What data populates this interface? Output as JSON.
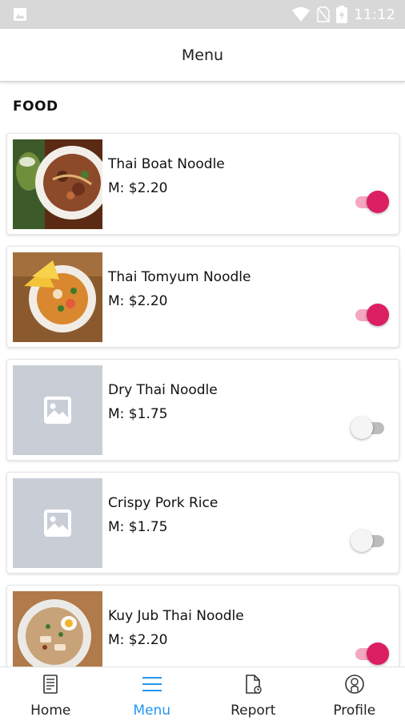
{
  "status_bar": {
    "time": "11:12"
  },
  "app_bar": {
    "title": "Menu"
  },
  "section": {
    "title": "FOOD"
  },
  "items": [
    {
      "name": "Thai Boat Noodle",
      "price": "M: $2.20",
      "enabled": true,
      "image": "boat-noodle-photo"
    },
    {
      "name": "Thai Tomyum Noodle",
      "price": "M: $2.20",
      "enabled": true,
      "image": "tomyum-noodle-photo"
    },
    {
      "name": "Dry Thai Noodle",
      "price": "M: $1.75",
      "enabled": false,
      "image": "placeholder-image-icon"
    },
    {
      "name": "Crispy Pork Rice",
      "price": "M: $1.75",
      "enabled": false,
      "image": "placeholder-image-icon"
    },
    {
      "name": "Kuy Jub Thai Noodle",
      "price": "M: $2.20",
      "enabled": true,
      "image": "kuy-jub-noodle-photo"
    }
  ],
  "nav": {
    "home": "Home",
    "menu": "Menu",
    "report": "Report",
    "profile": "Profile",
    "active": "menu"
  },
  "colors": {
    "accent": "#dc1e63",
    "nav_active": "#2196f3"
  }
}
